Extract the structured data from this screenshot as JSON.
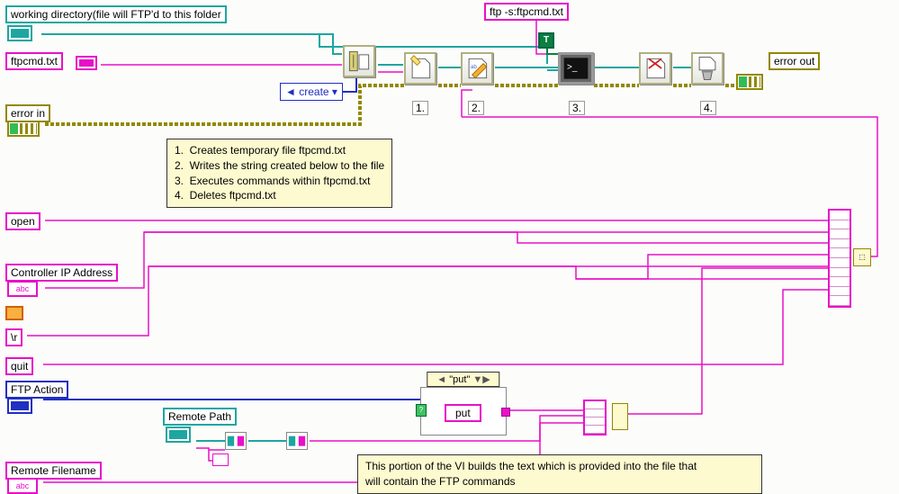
{
  "labels": {
    "workingDir": "working directory(file will FTP'd to this folder",
    "ftpcmd": "ftpcmd.txt",
    "errorIn": "error in",
    "errorOut": "error out",
    "ftpS": "ftp -s:ftpcmd.txt",
    "open": "open",
    "controllerIp": "Controller IP Address",
    "cr": "\\r",
    "quit": "quit",
    "ftpAction": "FTP Action",
    "remotePath": "Remote Path",
    "remoteFilename": "Remote Filename",
    "createConst": "create"
  },
  "steps": {
    "n1": "1.",
    "n2": "2.",
    "n3": "3.",
    "n4": "4."
  },
  "notes": {
    "main": "1.  Creates temporary file ftpcmd.txt\n2.  Writes the string created below to the file\n3.  Executes commands within ftpcmd.txt\n4.  Deletes ftpcmd.txt",
    "bottom": "This portion of the VI builds the text which is provided into the file that\nwill contain the FTP commands"
  },
  "caseSelector": "\"put\"",
  "caseValue": "put",
  "boolTrue": "T"
}
